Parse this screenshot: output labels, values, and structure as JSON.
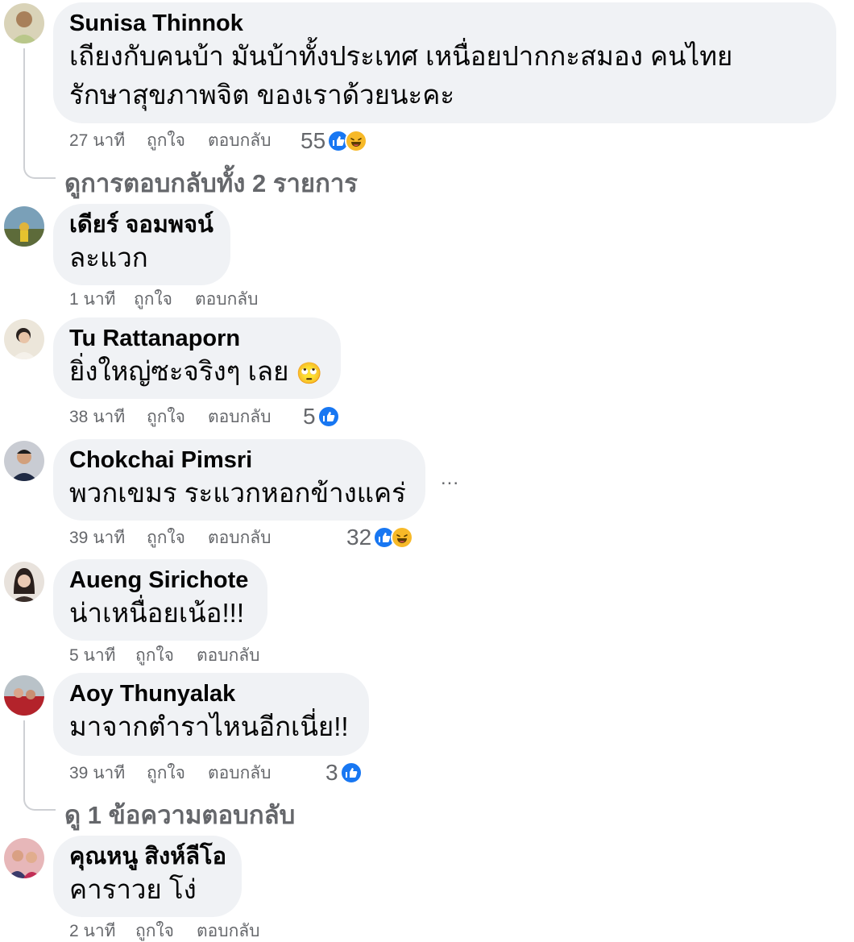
{
  "actions": {
    "like": "ถูกใจ",
    "reply": "ตอบกลับ"
  },
  "colors": {
    "like": "#1877f2",
    "haha": "#f7b928",
    "bubble": "#f0f2f5",
    "meta": "#65676b"
  },
  "comments": [
    {
      "author": "Sunisa Thinnok",
      "lines": [
        "เถียงกับคนบ้า มันบ้าทั้งประเทศ เหนื่อยปากกะสมอง คนไทย",
        "รักษาสุขภาพจิต ของเราด้วยนะคะ"
      ],
      "time": "27 นาที",
      "reaction_count": "55",
      "reaction_icons": [
        "like-icon",
        "haha-icon"
      ],
      "replies_label": "ดูการตอบกลับทั้ง 2 รายการ"
    },
    {
      "author": "เดียร์ จอมพจน์",
      "lines": [
        "ละแวก"
      ],
      "time": "1 นาที"
    },
    {
      "author": "Tu Rattanaporn",
      "lines": [
        "ยิ่งใหญ่ซะจริงๆ เลย"
      ],
      "emoji": "🙄",
      "time": "38 นาที",
      "reaction_count": "5",
      "reaction_icons": [
        "like-icon"
      ]
    },
    {
      "author": "Chokchai Pimsri",
      "lines": [
        "พวกเขมร ระแวกหอกข้างแคร่"
      ],
      "time": "39 นาที",
      "reaction_count": "32",
      "reaction_icons": [
        "like-icon",
        "haha-icon"
      ],
      "more": "..."
    },
    {
      "author": "Aueng Sirichote",
      "lines": [
        "น่าเหนื่อยเน้อ!!!"
      ],
      "time": "5 นาที"
    },
    {
      "author": "Aoy Thunyalak",
      "lines": [
        "มาจากตำราไหนอีกเนี่ย!!"
      ],
      "time": "39 นาที",
      "reaction_count": "3",
      "reaction_icons": [
        "like-icon"
      ],
      "replies_label": "ดู 1 ข้อความตอบกลับ"
    },
    {
      "author": "คุณหนู สิงห์ลีโอ",
      "lines": [
        "คาราวย โง่"
      ],
      "time": "2 นาที"
    }
  ]
}
